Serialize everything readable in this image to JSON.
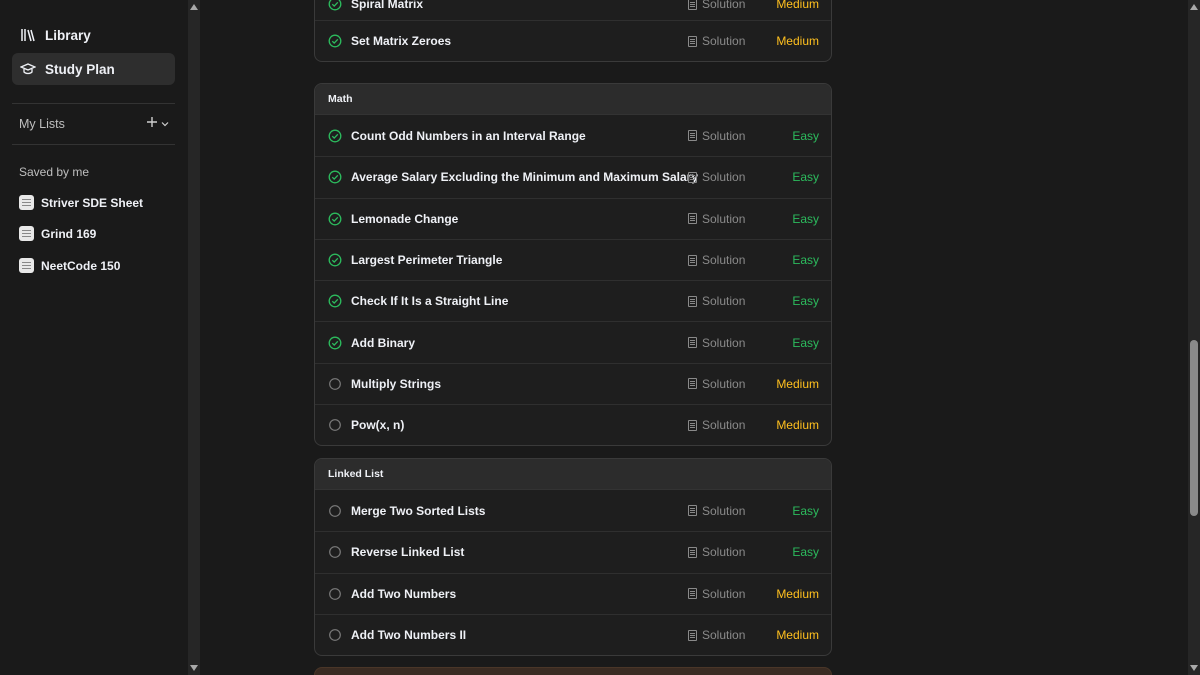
{
  "sidebar": {
    "nav": [
      {
        "label": "Library",
        "icon": "library-icon",
        "active": false
      },
      {
        "label": "Study Plan",
        "icon": "graduation-cap-icon",
        "active": true
      }
    ],
    "my_lists_label": "My Lists",
    "saved_label": "Saved by me",
    "saved_lists": [
      {
        "label": "Striver SDE Sheet"
      },
      {
        "label": "Grind 169"
      },
      {
        "label": "NeetCode 150"
      }
    ]
  },
  "colors": {
    "easy": "#2cbb5d",
    "medium": "#ffc01e",
    "solved": "#2cbb5d"
  },
  "groups": [
    {
      "title": "",
      "partial_top": true,
      "problems": [
        {
          "title": "Spiral Matrix",
          "solution": "Solution",
          "difficulty": "Medium",
          "solved": true
        },
        {
          "title": "Set Matrix Zeroes",
          "solution": "Solution",
          "difficulty": "Medium",
          "solved": true
        }
      ]
    },
    {
      "title": "Math",
      "problems": [
        {
          "title": "Count Odd Numbers in an Interval Range",
          "solution": "Solution",
          "difficulty": "Easy",
          "solved": true
        },
        {
          "title": "Average Salary Excluding the Minimum and Maximum Salary",
          "solution": "Solution",
          "difficulty": "Easy",
          "solved": true
        },
        {
          "title": "Lemonade Change",
          "solution": "Solution",
          "difficulty": "Easy",
          "solved": true
        },
        {
          "title": "Largest Perimeter Triangle",
          "solution": "Solution",
          "difficulty": "Easy",
          "solved": true
        },
        {
          "title": "Check If It Is a Straight Line",
          "solution": "Solution",
          "difficulty": "Easy",
          "solved": true
        },
        {
          "title": "Add Binary",
          "solution": "Solution",
          "difficulty": "Easy",
          "solved": true
        },
        {
          "title": "Multiply Strings",
          "solution": "Solution",
          "difficulty": "Medium",
          "solved": false
        },
        {
          "title": "Pow(x, n)",
          "solution": "Solution",
          "difficulty": "Medium",
          "solved": false
        }
      ]
    },
    {
      "title": "Linked List",
      "problems": [
        {
          "title": "Merge Two Sorted Lists",
          "solution": "Solution",
          "difficulty": "Easy",
          "solved": false
        },
        {
          "title": "Reverse Linked List",
          "solution": "Solution",
          "difficulty": "Easy",
          "solved": false
        },
        {
          "title": "Add Two Numbers",
          "solution": "Solution",
          "difficulty": "Medium",
          "solved": false
        },
        {
          "title": "Add Two Numbers II",
          "solution": "Solution",
          "difficulty": "Medium",
          "solved": false
        }
      ]
    }
  ]
}
